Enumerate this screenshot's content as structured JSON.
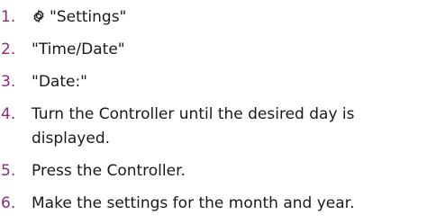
{
  "steps": [
    {
      "number": "1.",
      "icon": "settings-gear-icon",
      "text": "\"Settings\""
    },
    {
      "number": "2.",
      "text": "\"Time/Date\""
    },
    {
      "number": "3.",
      "text": "\"Date:\""
    },
    {
      "number": "4.",
      "text": "Turn the Controller until the desired day is displayed."
    },
    {
      "number": "5.",
      "text": "Press the Controller."
    },
    {
      "number": "6.",
      "text": "Make the settings for the month and year."
    }
  ],
  "colors": {
    "step_number": "#8b2a78",
    "text": "#1a1a1a",
    "background": "#ffffff"
  }
}
